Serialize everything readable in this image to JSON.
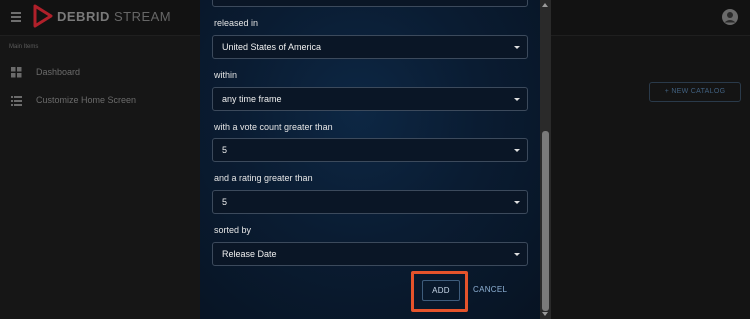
{
  "app": {
    "brand_bold": "DEBRID",
    "brand_light": "STREAM",
    "section_header": "Main Items",
    "nav": [
      {
        "label": "Dashboard",
        "icon": "dashboard-icon"
      },
      {
        "label": "Customize Home Screen",
        "icon": "list-icon"
      }
    ],
    "new_catalog_label": "+ NEW CATALOG"
  },
  "dialog": {
    "fields": [
      {
        "label": "released in",
        "value": "United States of America"
      },
      {
        "label": "within",
        "value": "any time frame"
      },
      {
        "label": "with a vote count greater than",
        "value": "5"
      },
      {
        "label": "and a rating greater than",
        "value": "5"
      },
      {
        "label": "sorted by",
        "value": "Release Date"
      }
    ],
    "add_label": "ADD",
    "cancel_label": "CANCEL"
  },
  "colors": {
    "highlight": "#e5532b",
    "dialog_bg": "#0a1c32",
    "accent_link": "#8fb2d6"
  }
}
